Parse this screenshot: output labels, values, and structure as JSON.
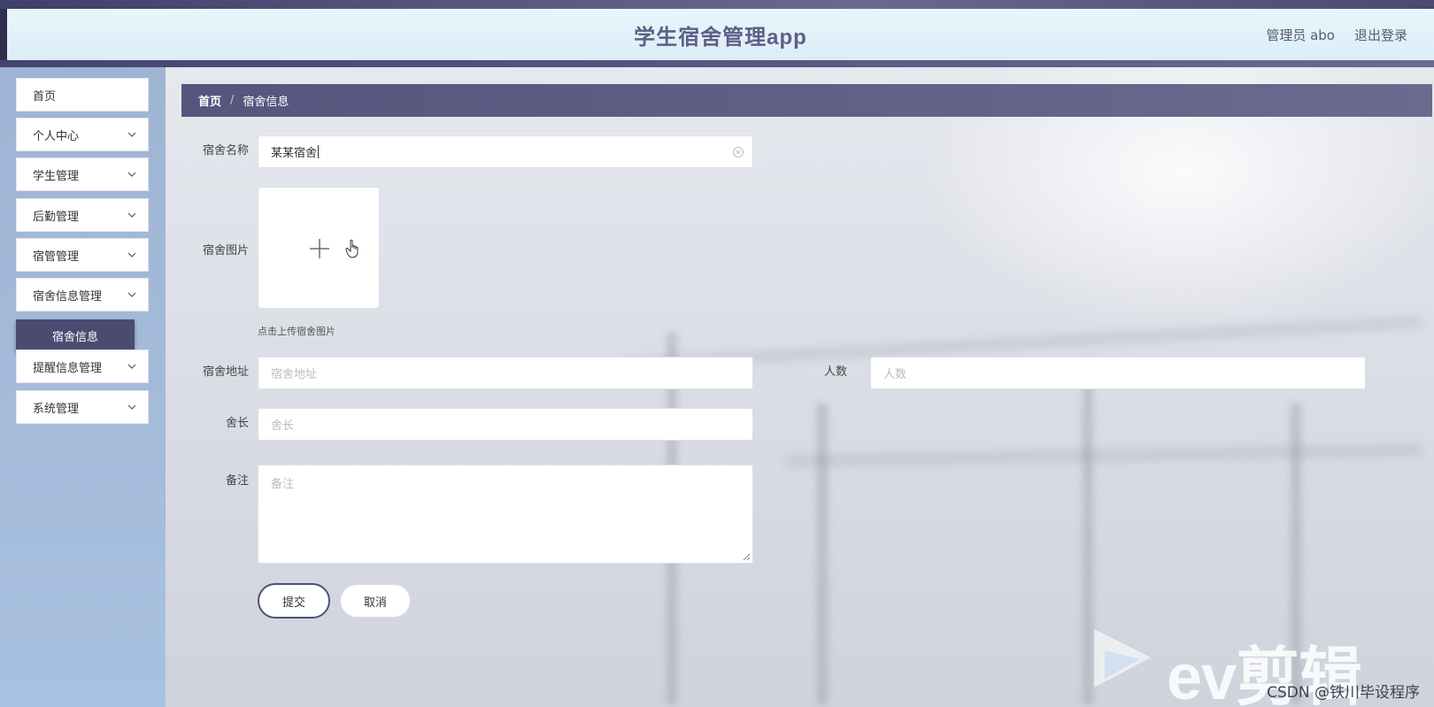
{
  "header": {
    "title": "学生宿舍管理app",
    "user_label": "管理员 abo",
    "logout_label": "退出登录"
  },
  "sidebar": {
    "items": [
      {
        "label": "首页",
        "has_chevron": false
      },
      {
        "label": "个人中心",
        "has_chevron": true
      },
      {
        "label": "学生管理",
        "has_chevron": true
      },
      {
        "label": "后勤管理",
        "has_chevron": true
      },
      {
        "label": "宿管管理",
        "has_chevron": true
      },
      {
        "label": "宿舍信息管理",
        "has_chevron": true
      },
      {
        "label": "提醒信息管理",
        "has_chevron": true
      },
      {
        "label": "系统管理",
        "has_chevron": true
      }
    ],
    "active_sub": "宿舍信息"
  },
  "breadcrumb": {
    "home": "首页",
    "separator": "/",
    "current": "宿舍信息"
  },
  "form": {
    "name_label": "宿舍名称",
    "name_value": "某某宿舍",
    "image_label": "宿舍图片",
    "upload_tip": "点击上传宿舍图片",
    "address_label": "宿舍地址",
    "address_placeholder": "宿舍地址",
    "count_label": "人数",
    "count_placeholder": "人数",
    "leader_label": "舍长",
    "leader_placeholder": "舍长",
    "remark_label": "备注",
    "remark_placeholder": "备注",
    "submit_label": "提交",
    "cancel_label": "取消"
  },
  "watermark": {
    "text": "ev剪辑",
    "credit": "CSDN @铁川毕设程序"
  },
  "colors": {
    "accent": "#4b4b72",
    "header_bg": "#e4f2f9",
    "sidebar_bg": "#a3b9d8",
    "title_color": "#5d5f86"
  }
}
